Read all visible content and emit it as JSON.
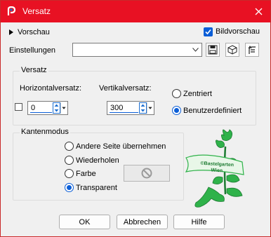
{
  "window": {
    "title": "Versatz"
  },
  "header": {
    "preview_toggle_label": "Vorschau",
    "image_preview_label": "Bildvorschau",
    "image_preview_checked": true
  },
  "settings": {
    "label": "Einstellungen",
    "value": ""
  },
  "offset_group": {
    "title": "Versatz",
    "horizontal_label": "Horizontalversatz:",
    "horizontal_value": "0",
    "vertical_label": "Vertikalversatz:",
    "vertical_value": "300",
    "position_options": [
      "Zentriert",
      "Benutzerdefiniert"
    ],
    "position_selected": "Benutzerdefiniert"
  },
  "edge_group": {
    "title": "Kantenmodus",
    "options": [
      "Andere Seite übernehmen",
      "Wiederholen",
      "Farbe",
      "Transparent"
    ],
    "selected": "Transparent"
  },
  "watermark": {
    "line1": "©Bastelgarten",
    "line2": "Wien",
    "color": "#2fb24a"
  },
  "buttons": {
    "ok": "OK",
    "cancel": "Abbrechen",
    "help": "Hilfe"
  },
  "colors": {
    "titlebar": "#e81123",
    "accent": "#0b5ed7"
  }
}
